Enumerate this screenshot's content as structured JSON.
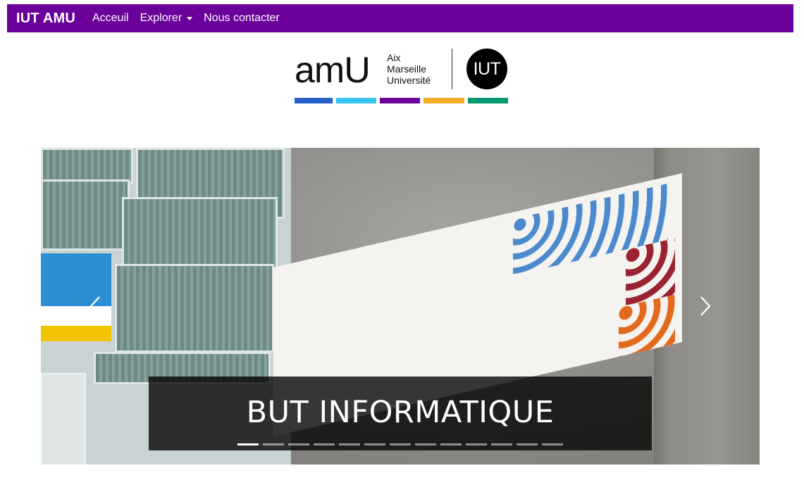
{
  "navbar": {
    "brand": "IUT AMU",
    "links": [
      "Acceuil",
      "Explorer",
      "Nous contacter"
    ],
    "background": "#6a0099"
  },
  "logo": {
    "wordmark": "amU",
    "lines": [
      "Aix",
      "Marseille",
      "Université"
    ],
    "badge": "IUT",
    "color_bars": [
      "#2460c8",
      "#37c3f0",
      "#6a0099",
      "#f5b02a",
      "#009971"
    ]
  },
  "carousel": {
    "caption": "BUT INFORMATIQUE",
    "slide_count": 13,
    "active_index": 0,
    "prev_icon": "chevron-left-icon",
    "next_icon": "chevron-right-icon"
  }
}
